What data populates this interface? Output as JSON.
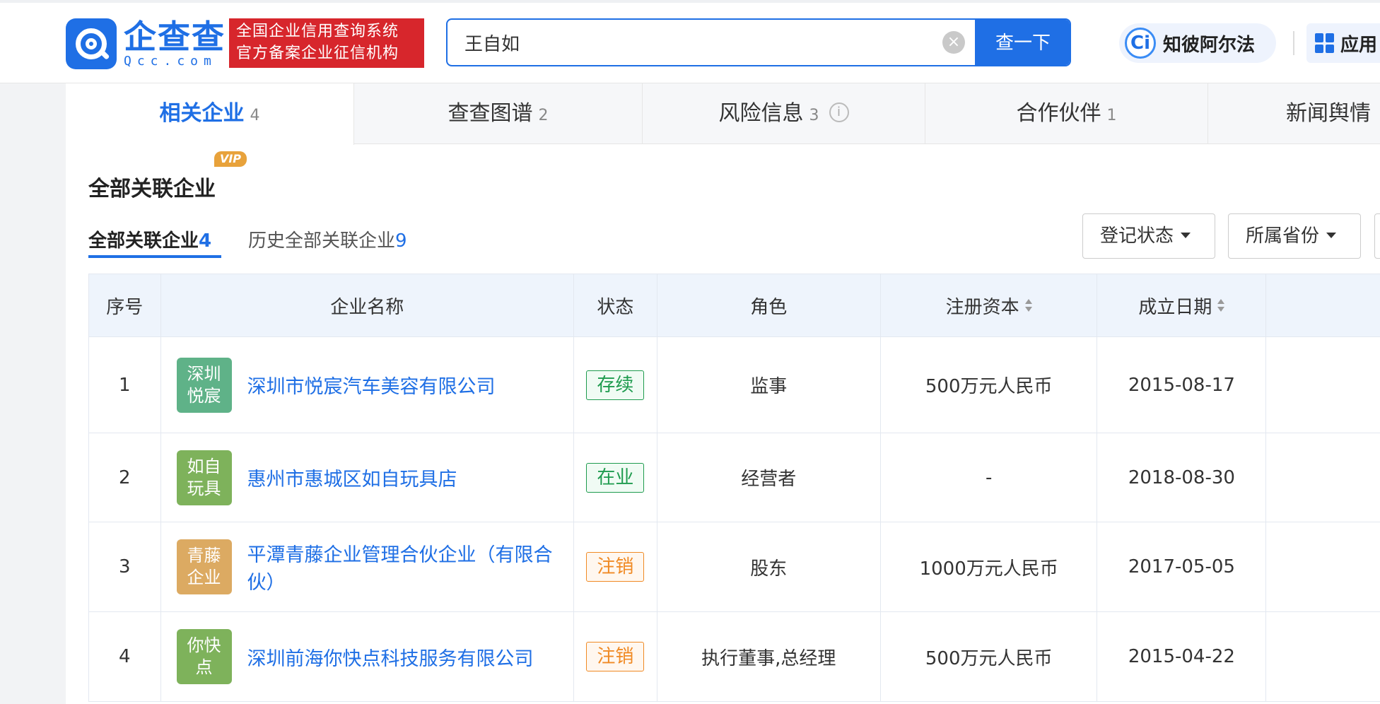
{
  "header": {
    "logo_cn": "企查查",
    "logo_en": "Qcc.com",
    "slogan_line1": "全国企业信用查询系统",
    "slogan_line2": "官方备案企业征信机构",
    "search_value": "王自如",
    "search_button": "查一下",
    "ai_icon": "Ci",
    "ai_label": "知彼阿尔法",
    "apps_label": "应用"
  },
  "tabs": [
    {
      "label": "相关企业",
      "count": "4"
    },
    {
      "label": "查查图谱",
      "count": "2"
    },
    {
      "label": "风险信息",
      "count": "3"
    },
    {
      "label": "合作伙伴",
      "count": "1"
    },
    {
      "label": "新闻舆情",
      "count": ""
    }
  ],
  "section": {
    "title": "全部关联企业",
    "vip_badge": "VIP",
    "subtab_current_label": "全部关联企业",
    "subtab_current_count": "4",
    "subtab_history_label": "历史全部关联企业",
    "subtab_history_count": "9",
    "filter_status": "登记状态",
    "filter_province": "所属省份"
  },
  "table": {
    "headers": {
      "index": "序号",
      "name": "企业名称",
      "status": "状态",
      "role": "角色",
      "capital": "注册资本",
      "founded": "成立日期"
    },
    "rows": [
      {
        "index": "1",
        "logo": "深圳悦宸",
        "logo_color": "#5fb288",
        "name": "深圳市悦宸汽车美容有限公司",
        "status": "存续",
        "status_color": "green",
        "role": "监事",
        "capital": "500万元人民币",
        "founded": "2015-08-17"
      },
      {
        "index": "2",
        "logo": "如自玩具",
        "logo_color": "#7eb25b",
        "name": "惠州市惠城区如自玩具店",
        "status": "在业",
        "status_color": "green",
        "role": "经营者",
        "capital": "-",
        "founded": "2018-08-30"
      },
      {
        "index": "3",
        "logo": "青藤企业",
        "logo_color": "#dcaa62",
        "name": "平潭青藤企业管理合伙企业（有限合伙）",
        "status": "注销",
        "status_color": "orange",
        "role": "股东",
        "capital": "1000万元人民币",
        "founded": "2017-05-05"
      },
      {
        "index": "4",
        "logo": "你快点",
        "logo_color": "#7eb25b",
        "name": "深圳前海你快点科技服务有限公司",
        "status": "注销",
        "status_color": "orange",
        "role": "执行董事,总经理",
        "capital": "500万元人民币",
        "founded": "2015-04-22"
      }
    ]
  }
}
